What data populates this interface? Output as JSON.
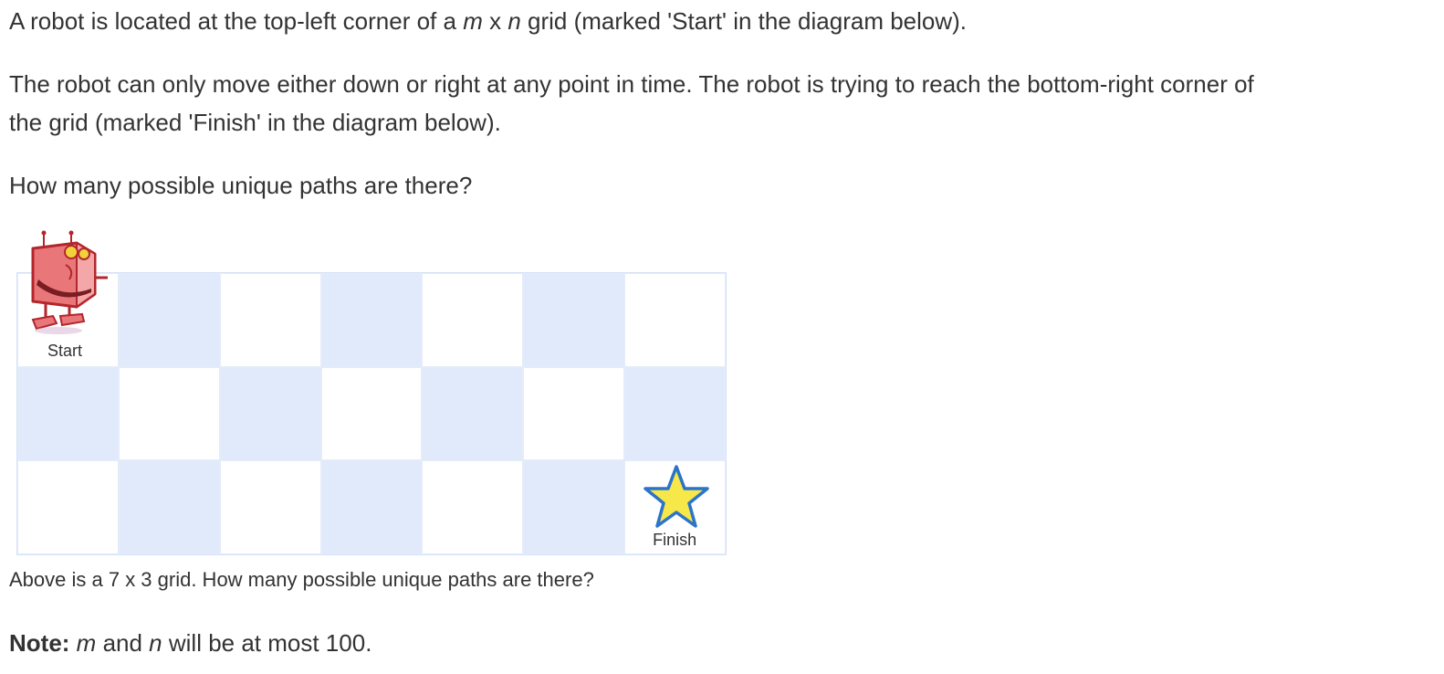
{
  "problem": {
    "p1": {
      "before": "A robot is located at the top-left corner of a ",
      "m": "m",
      "x": " x ",
      "n": "n",
      "after": " grid (marked 'Start' in the diagram below)."
    },
    "p2": {
      "line1": "The robot can only move either down or right at any point in time. The robot is trying to reach the bottom-right corner of",
      "line2": "the grid (marked 'Finish' in the diagram below)."
    },
    "p3": "How many possible unique paths are there?",
    "caption": "Above is a 7 x 3 grid. How many possible unique paths are there?",
    "note": {
      "label": "Note:",
      "m": "m",
      "mid": " and ",
      "n": "n",
      "rest": " will be at most 100."
    }
  },
  "diagram": {
    "columns": 7,
    "rows": 3,
    "start_label": "Start",
    "finish_label": "Finish",
    "colors": {
      "shaded_cell": "#e1eafb",
      "light_cell": "#ffffff",
      "star_fill": "#f7e84a",
      "star_stroke": "#2b74c9",
      "robot_body": "#e9777a",
      "robot_outline": "#b3262c"
    },
    "icons": {
      "start": "robot-icon",
      "finish": "star-icon"
    }
  }
}
